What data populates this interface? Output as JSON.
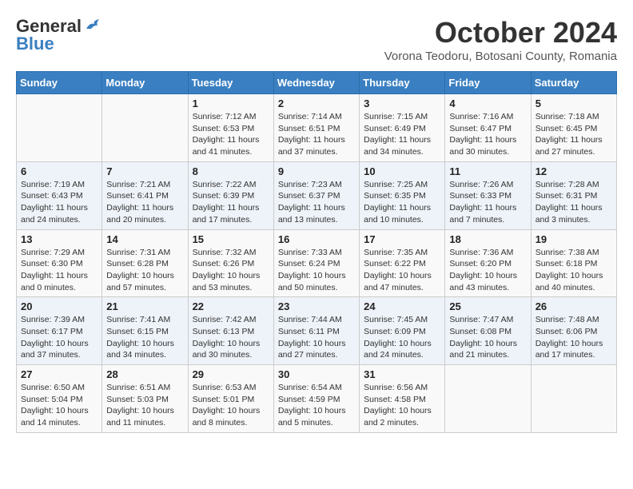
{
  "header": {
    "logo_line1": "General",
    "logo_line2": "Blue",
    "month": "October 2024",
    "location": "Vorona Teodoru, Botosani County, Romania"
  },
  "weekdays": [
    "Sunday",
    "Monday",
    "Tuesday",
    "Wednesday",
    "Thursday",
    "Friday",
    "Saturday"
  ],
  "weeks": [
    [
      {
        "day": "",
        "info": ""
      },
      {
        "day": "",
        "info": ""
      },
      {
        "day": "1",
        "info": "Sunrise: 7:12 AM\nSunset: 6:53 PM\nDaylight: 11 hours and 41 minutes."
      },
      {
        "day": "2",
        "info": "Sunrise: 7:14 AM\nSunset: 6:51 PM\nDaylight: 11 hours and 37 minutes."
      },
      {
        "day": "3",
        "info": "Sunrise: 7:15 AM\nSunset: 6:49 PM\nDaylight: 11 hours and 34 minutes."
      },
      {
        "day": "4",
        "info": "Sunrise: 7:16 AM\nSunset: 6:47 PM\nDaylight: 11 hours and 30 minutes."
      },
      {
        "day": "5",
        "info": "Sunrise: 7:18 AM\nSunset: 6:45 PM\nDaylight: 11 hours and 27 minutes."
      }
    ],
    [
      {
        "day": "6",
        "info": "Sunrise: 7:19 AM\nSunset: 6:43 PM\nDaylight: 11 hours and 24 minutes."
      },
      {
        "day": "7",
        "info": "Sunrise: 7:21 AM\nSunset: 6:41 PM\nDaylight: 11 hours and 20 minutes."
      },
      {
        "day": "8",
        "info": "Sunrise: 7:22 AM\nSunset: 6:39 PM\nDaylight: 11 hours and 17 minutes."
      },
      {
        "day": "9",
        "info": "Sunrise: 7:23 AM\nSunset: 6:37 PM\nDaylight: 11 hours and 13 minutes."
      },
      {
        "day": "10",
        "info": "Sunrise: 7:25 AM\nSunset: 6:35 PM\nDaylight: 11 hours and 10 minutes."
      },
      {
        "day": "11",
        "info": "Sunrise: 7:26 AM\nSunset: 6:33 PM\nDaylight: 11 hours and 7 minutes."
      },
      {
        "day": "12",
        "info": "Sunrise: 7:28 AM\nSunset: 6:31 PM\nDaylight: 11 hours and 3 minutes."
      }
    ],
    [
      {
        "day": "13",
        "info": "Sunrise: 7:29 AM\nSunset: 6:30 PM\nDaylight: 11 hours and 0 minutes."
      },
      {
        "day": "14",
        "info": "Sunrise: 7:31 AM\nSunset: 6:28 PM\nDaylight: 10 hours and 57 minutes."
      },
      {
        "day": "15",
        "info": "Sunrise: 7:32 AM\nSunset: 6:26 PM\nDaylight: 10 hours and 53 minutes."
      },
      {
        "day": "16",
        "info": "Sunrise: 7:33 AM\nSunset: 6:24 PM\nDaylight: 10 hours and 50 minutes."
      },
      {
        "day": "17",
        "info": "Sunrise: 7:35 AM\nSunset: 6:22 PM\nDaylight: 10 hours and 47 minutes."
      },
      {
        "day": "18",
        "info": "Sunrise: 7:36 AM\nSunset: 6:20 PM\nDaylight: 10 hours and 43 minutes."
      },
      {
        "day": "19",
        "info": "Sunrise: 7:38 AM\nSunset: 6:18 PM\nDaylight: 10 hours and 40 minutes."
      }
    ],
    [
      {
        "day": "20",
        "info": "Sunrise: 7:39 AM\nSunset: 6:17 PM\nDaylight: 10 hours and 37 minutes."
      },
      {
        "day": "21",
        "info": "Sunrise: 7:41 AM\nSunset: 6:15 PM\nDaylight: 10 hours and 34 minutes."
      },
      {
        "day": "22",
        "info": "Sunrise: 7:42 AM\nSunset: 6:13 PM\nDaylight: 10 hours and 30 minutes."
      },
      {
        "day": "23",
        "info": "Sunrise: 7:44 AM\nSunset: 6:11 PM\nDaylight: 10 hours and 27 minutes."
      },
      {
        "day": "24",
        "info": "Sunrise: 7:45 AM\nSunset: 6:09 PM\nDaylight: 10 hours and 24 minutes."
      },
      {
        "day": "25",
        "info": "Sunrise: 7:47 AM\nSunset: 6:08 PM\nDaylight: 10 hours and 21 minutes."
      },
      {
        "day": "26",
        "info": "Sunrise: 7:48 AM\nSunset: 6:06 PM\nDaylight: 10 hours and 17 minutes."
      }
    ],
    [
      {
        "day": "27",
        "info": "Sunrise: 6:50 AM\nSunset: 5:04 PM\nDaylight: 10 hours and 14 minutes."
      },
      {
        "day": "28",
        "info": "Sunrise: 6:51 AM\nSunset: 5:03 PM\nDaylight: 10 hours and 11 minutes."
      },
      {
        "day": "29",
        "info": "Sunrise: 6:53 AM\nSunset: 5:01 PM\nDaylight: 10 hours and 8 minutes."
      },
      {
        "day": "30",
        "info": "Sunrise: 6:54 AM\nSunset: 4:59 PM\nDaylight: 10 hours and 5 minutes."
      },
      {
        "day": "31",
        "info": "Sunrise: 6:56 AM\nSunset: 4:58 PM\nDaylight: 10 hours and 2 minutes."
      },
      {
        "day": "",
        "info": ""
      },
      {
        "day": "",
        "info": ""
      }
    ]
  ]
}
